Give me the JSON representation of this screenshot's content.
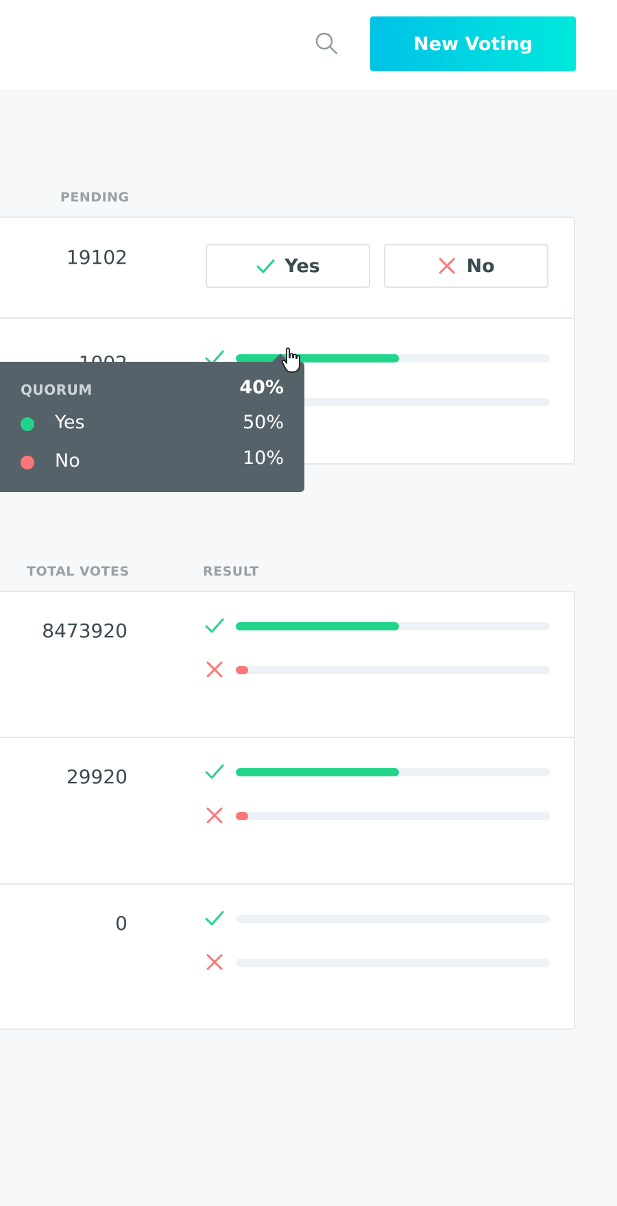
{
  "header": {
    "search_icon": "search-icon",
    "new_voting_label": "New Voting",
    "accent_gradient": [
      "#00c2e6",
      "#00e8dd"
    ]
  },
  "pending": {
    "column_label": "PENDING",
    "rows": [
      {
        "votes": "19102",
        "yes_label": "Yes",
        "no_label": "No"
      },
      {
        "votes": "1002",
        "yes_fraction": 0.52,
        "no_fraction": 0.04
      }
    ]
  },
  "tooltip": {
    "title": "QUORUM",
    "quorum_value": "40%",
    "items": [
      {
        "label": "Yes",
        "value": "50%",
        "color": "#21d48a"
      },
      {
        "label": "No",
        "value": "10%",
        "color": "#fb7777"
      }
    ]
  },
  "closed": {
    "total_votes_label": "TOTAL VOTES",
    "result_label": "RESULT",
    "rows": [
      {
        "votes": "8473920",
        "yes_fraction": 0.52,
        "no_fraction": 0.04
      },
      {
        "votes": "29920",
        "yes_fraction": 0.52,
        "no_fraction": 0.04
      },
      {
        "votes": "0",
        "yes_fraction": 0,
        "no_fraction": 0
      }
    ]
  },
  "colors": {
    "yes": "#21d48a",
    "no": "#fb7777",
    "track": "#edf2f6"
  }
}
